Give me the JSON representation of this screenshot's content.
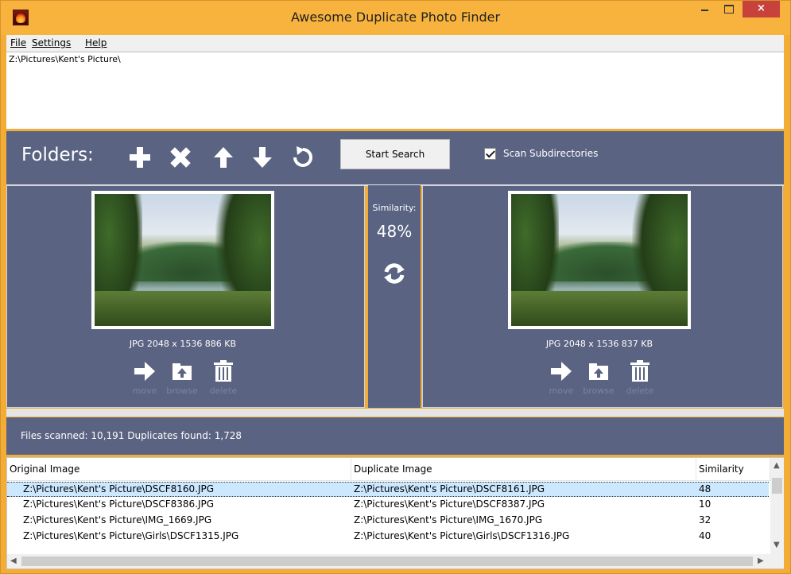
{
  "window": {
    "title": "Awesome Duplicate Photo Finder",
    "close_label": "×"
  },
  "menu": {
    "file": "File",
    "settings": "Settings",
    "help": "Help"
  },
  "folders": {
    "list": [
      "Z:\\Pictures\\Kent's Picture\\"
    ],
    "label": "Folders:",
    "icons": [
      "plus-icon",
      "close-icon",
      "arrow-up-icon",
      "arrow-down-icon",
      "refresh-icon"
    ],
    "start_button": "Start Search",
    "scan_subdirs_label": "Scan Subdirectories",
    "scan_subdirs_checked": true
  },
  "compare": {
    "left": {
      "info": "JPG  2048 x 1536  886 KB",
      "actions": [
        "move",
        "browse",
        "delete"
      ]
    },
    "right": {
      "info": "JPG  2048 x 1536  837 KB",
      "actions": [
        "move",
        "browse",
        "delete"
      ]
    },
    "similarity_label": "Similarity:",
    "similarity_value": "48%"
  },
  "status": {
    "text": "Files scanned: 10,191  Duplicates found: 1,728"
  },
  "table": {
    "columns": [
      "Original Image",
      "Duplicate Image",
      "Similarity"
    ],
    "rows": [
      {
        "original": "Z:\\Pictures\\Kent's Picture\\DSCF8160.JPG",
        "duplicate": "Z:\\Pictures\\Kent's Picture\\DSCF8161.JPG",
        "similarity": "48"
      },
      {
        "original": "Z:\\Pictures\\Kent's Picture\\DSCF8386.JPG",
        "duplicate": "Z:\\Pictures\\Kent's Picture\\DSCF8387.JPG",
        "similarity": "10"
      },
      {
        "original": "Z:\\Pictures\\Kent's Picture\\IMG_1669.JPG",
        "duplicate": "Z:\\Pictures\\Kent's Picture\\IMG_1670.JPG",
        "similarity": "32"
      },
      {
        "original": "Z:\\Pictures\\Kent's Picture\\Girls\\DSCF1315.JPG",
        "duplicate": "Z:\\Pictures\\Kent's Picture\\Girls\\DSCF1316.JPG",
        "similarity": "40"
      }
    ]
  },
  "colors": {
    "title_bar": "#f7b33d",
    "panel": "#5a6482",
    "close_button": "#c7423a",
    "selected_row": "#cce8ff"
  }
}
